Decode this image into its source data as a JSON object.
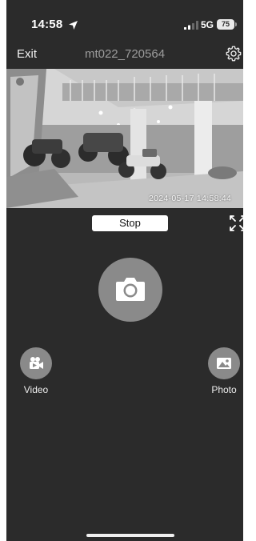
{
  "status_bar": {
    "time": "14:58",
    "network": "5G",
    "battery": "75",
    "icons": [
      "location-arrow-icon",
      "signal-bars-icon",
      "battery-icon"
    ]
  },
  "nav": {
    "exit_label": "Exit",
    "title": "mt022_720564",
    "settings_icon": "gear-icon"
  },
  "feed": {
    "timestamp": "2024-05-17  14:58:44"
  },
  "controls": {
    "stop_label": "Stop",
    "fullscreen_icon": "expand-arrows-icon",
    "snapshot_icon": "camera-icon",
    "video_label": "Video",
    "video_icon": "video-camera-icon",
    "photo_label": "Photo",
    "photo_icon": "image-icon"
  },
  "colors": {
    "background": "#2b2b2b",
    "button_gray": "#8a8a8a",
    "title_gray": "#9c9c9c",
    "white": "#ffffff"
  }
}
